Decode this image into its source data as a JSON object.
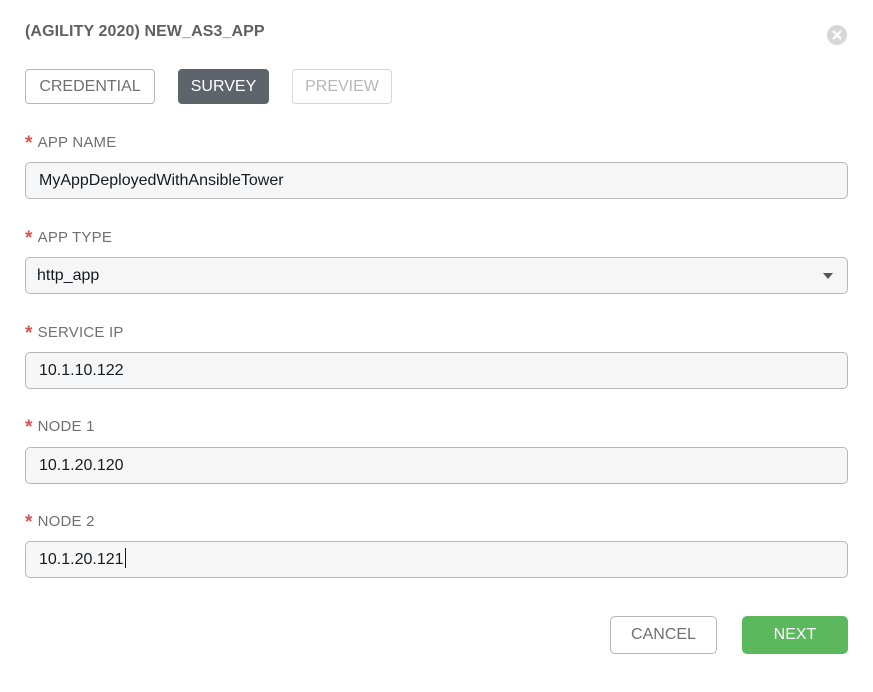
{
  "modal": {
    "title": "(AGILITY 2020) NEW_AS3_APP"
  },
  "tabs": [
    {
      "label": "CREDENTIAL",
      "state": "inactive"
    },
    {
      "label": "SURVEY",
      "state": "active"
    },
    {
      "label": "PREVIEW",
      "state": "disabled"
    }
  ],
  "fields": {
    "app_name": {
      "label": "APP NAME",
      "required_mark": "*",
      "value": "MyAppDeployedWithAnsibleTower"
    },
    "app_type": {
      "label": "APP TYPE",
      "required_mark": "*",
      "value": "http_app"
    },
    "service_ip": {
      "label": "SERVICE IP",
      "required_mark": "*",
      "value": "10.1.10.122"
    },
    "node1": {
      "label": "NODE 1",
      "required_mark": "*",
      "value": "10.1.20.120"
    },
    "node2": {
      "label": "NODE 2",
      "required_mark": "*",
      "value": "10.1.20.121"
    }
  },
  "footer": {
    "cancel_label": "CANCEL",
    "next_label": "NEXT"
  },
  "icons": {
    "close": "close-icon",
    "dropdown": "caret-down-icon"
  },
  "colors": {
    "required": "#d9534f",
    "active_tab": "#5e646c",
    "next_button": "#5cb85c"
  }
}
